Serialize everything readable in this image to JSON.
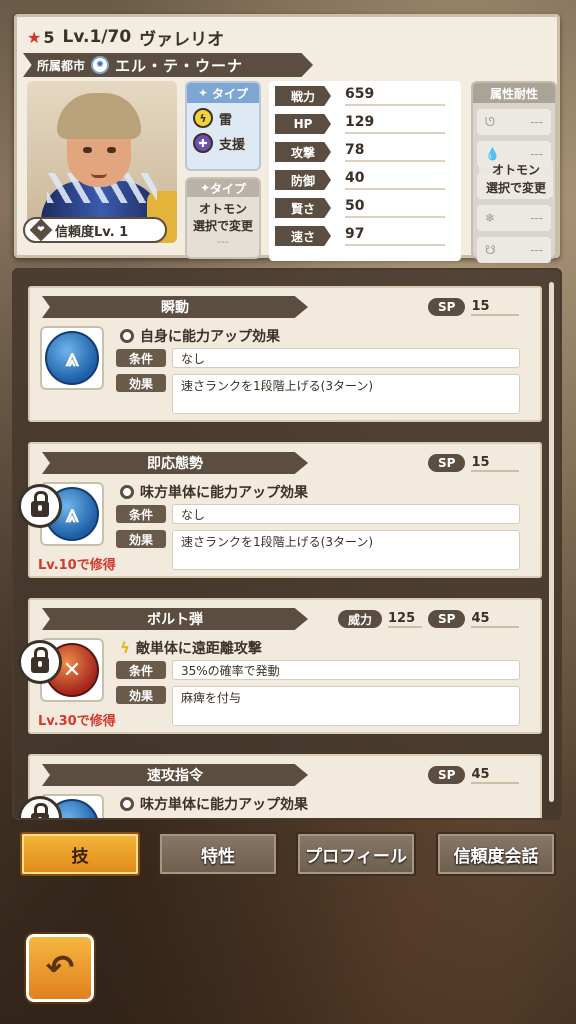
{
  "header": {
    "rarity": "5",
    "level": "Lv.1/70",
    "name": "ヴァレリオ",
    "city_label": "所属都市",
    "city_name": "エル・テ・ウーナ",
    "trust": "信頼度Lv.  1"
  },
  "type": {
    "title": "タイプ",
    "element": "雷",
    "role": "支援"
  },
  "otomon": {
    "title": "タイプ",
    "line1": "オトモン",
    "line2": "選択で変更",
    "dash": "---"
  },
  "stats": [
    {
      "label": "戦力",
      "value": "659"
    },
    {
      "label": "HP",
      "value": "129"
    },
    {
      "label": "攻撃",
      "value": "78"
    },
    {
      "label": "防御",
      "value": "40"
    },
    {
      "label": "賢さ",
      "value": "50"
    },
    {
      "label": "速さ",
      "value": "97"
    }
  ],
  "resist": {
    "title": "属性耐性",
    "dash": "---",
    "overlay1": "オトモン",
    "overlay2": "選択で変更"
  },
  "skills": [
    {
      "name": "瞬動",
      "sp_label": "SP",
      "sp": "15",
      "effect_title": "自身に能力アップ効果",
      "cond_label": "条件",
      "cond": "なし",
      "eff_label": "効果",
      "eff": "速さランクを1段階上げる(3ターン)"
    },
    {
      "name": "即応態勢",
      "sp_label": "SP",
      "sp": "15",
      "effect_title": "味方単体に能力アップ効果",
      "cond_label": "条件",
      "cond": "なし",
      "eff_label": "効果",
      "eff": "速さランクを1段階上げる(3ターン)",
      "unlock": "Lv.10で修得"
    },
    {
      "name": "ボルト弾",
      "power_label": "威力",
      "power": "125",
      "sp_label": "SP",
      "sp": "45",
      "effect_title": "敵単体に遠距離攻撃",
      "cond_label": "条件",
      "cond": "35%の確率で発動",
      "eff_label": "効果",
      "eff": "麻痺を付与",
      "unlock": "Lv.30で修得"
    },
    {
      "name": "速攻指令",
      "sp_label": "SP",
      "sp": "45",
      "effect_title": "味方単体に能力アップ効果"
    }
  ],
  "tabs": [
    "技",
    "特性",
    "プロフィール",
    "信頼度会話"
  ],
  "colors": {
    "accent": "#e08a1c",
    "ribbon": "#5b4d3f",
    "unlock_text": "#d23a30",
    "thunder": "#f2d23a"
  }
}
